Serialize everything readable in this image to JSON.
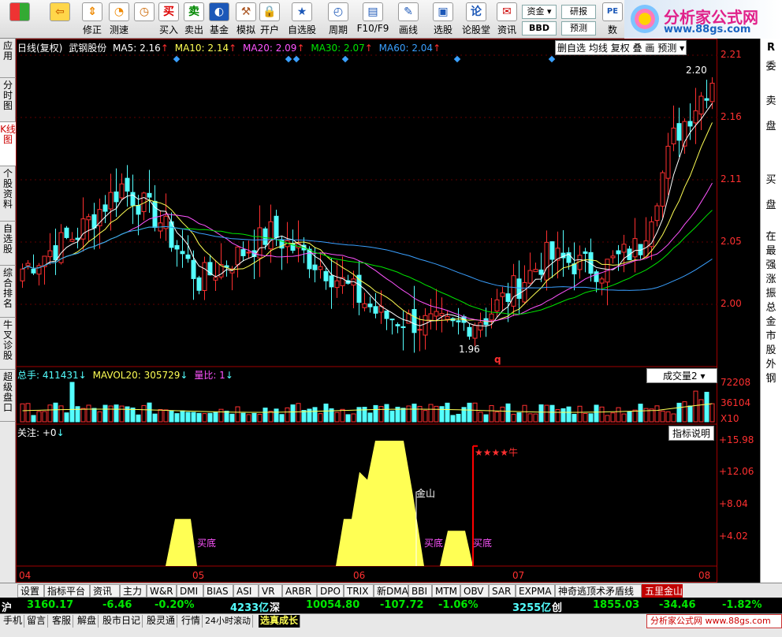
{
  "toolbar": {
    "buttons": [
      {
        "label": "",
        "icon": "grid-icon"
      },
      {
        "label": "",
        "icon": "back-arrow-icon"
      },
      {
        "label": "修正",
        "icon": "up-down-icon"
      },
      {
        "label": "测速",
        "icon": "speed-icon"
      },
      {
        "label": "买入",
        "icon": "buy-icon",
        "glyph": "买"
      },
      {
        "label": "卖出",
        "icon": "sell-icon",
        "glyph": "卖"
      },
      {
        "label": "基金",
        "icon": "fund-icon"
      },
      {
        "label": "模拟",
        "icon": "hammer-icon"
      },
      {
        "label": "开户",
        "icon": "lock-icon"
      },
      {
        "label": "自选股",
        "icon": "star-icon"
      },
      {
        "label": "周期",
        "icon": "clock-icon"
      },
      {
        "label": "F10/F9",
        "icon": "f10-icon"
      },
      {
        "label": "画线",
        "icon": "pencil-icon"
      },
      {
        "label": "选股",
        "icon": "screen-icon"
      },
      {
        "label": "论股堂",
        "icon": "forum-icon",
        "glyph": "论"
      },
      {
        "label": "资讯",
        "icon": "news-icon"
      },
      {
        "label": "数",
        "icon": "pe-icon"
      }
    ],
    "small": {
      "zijin": "资金",
      "bbd": "BBD",
      "yanbao": "研报",
      "yuce": "预测",
      "pe": "PE"
    }
  },
  "brand": {
    "name": "分析家公式网",
    "url": "www.88gs.com"
  },
  "left_tabs": [
    "应用",
    "分时图",
    "K线图",
    "个股资料",
    "自选股",
    "综合排名",
    "牛叉诊股",
    "超级盘口"
  ],
  "left_active": 2,
  "kline": {
    "title": "日线(复权)",
    "stock": "武钢股份",
    "ma5": "MA5: 2.16",
    "ma10": "MA10: 2.14",
    "ma20": "MA20: 2.09",
    "ma30": "MA30: 2.07",
    "ma60": "MA60: 2.04",
    "right_buttons": [
      "删自选",
      "均线",
      "复权",
      "叠",
      "画",
      "预测"
    ],
    "price_ticks": [
      "2.21",
      "2.16",
      "2.11",
      "2.05",
      "2.00"
    ],
    "high_label": "2.20",
    "low_label": "1.96",
    "q_mark": "q"
  },
  "volume": {
    "total": "总手: 411431",
    "mavol": "MAVOL20: 305729",
    "ratio": "量比: 1",
    "selector": "成交量2",
    "ticks": [
      "72208",
      "36104",
      "X10"
    ]
  },
  "indicator": {
    "title": "关注: +0",
    "help_btn": "指标说明",
    "ticks": [
      "+15.98",
      "+12.06",
      "+8.04",
      "+4.02"
    ],
    "labels": {
      "maidi1": "买底",
      "jinshan": "金山",
      "maidi2": "买底",
      "maidi3": "买底",
      "stars": "★★★★牛"
    }
  },
  "x_ticks": [
    "04",
    "05",
    "06",
    "07",
    "08"
  ],
  "right_panel": [
    "委",
    "卖",
    "盘",
    "买",
    "盘",
    "在",
    "最",
    "强",
    "涨",
    "振",
    "总",
    "金",
    "市",
    "股",
    "外",
    "钢"
  ],
  "bottom_tabs": [
    "设置",
    "指标平台",
    "资讯",
    "主力",
    "W&R",
    "DMI",
    "BIAS",
    "ASI",
    "VR",
    "ARBR",
    "DPO",
    "TRIX",
    "新DMA",
    "BBI",
    "MTM",
    "OBV",
    "SAR",
    "EXPMA",
    "神奇逃顶术矛盾线",
    "五里金山"
  ],
  "bottom_active": 19,
  "market": {
    "sh_name": "沪",
    "sh_index": "3160.17",
    "sh_change": "-6.46",
    "sh_pct": "-0.20%",
    "sh_amount": "4233亿",
    "sz_name": "深",
    "sz_index": "10054.80",
    "sz_change": "-107.72",
    "sz_pct": "-1.06%",
    "sz_amount": "3255亿",
    "cy_name": "创",
    "cy_index": "1855.03",
    "cy_change": "-34.46",
    "cy_pct": "-1.82%"
  },
  "status": {
    "items": [
      "手机",
      "留言",
      "客服",
      "解盘",
      "股市日记",
      "股灵通",
      "行情",
      "24小时滚动"
    ],
    "promo": "选真成长",
    "ad": "分析家公式网 www.88gs.com"
  },
  "colors": {
    "up": "#ff3030",
    "down": "#54ffff",
    "ma5": "#ffffff",
    "ma10": "#ffff54",
    "ma20": "#ff54ff",
    "ma30": "#00e600",
    "ma60": "#3aa0ff",
    "yellow": "#ffff54"
  }
}
